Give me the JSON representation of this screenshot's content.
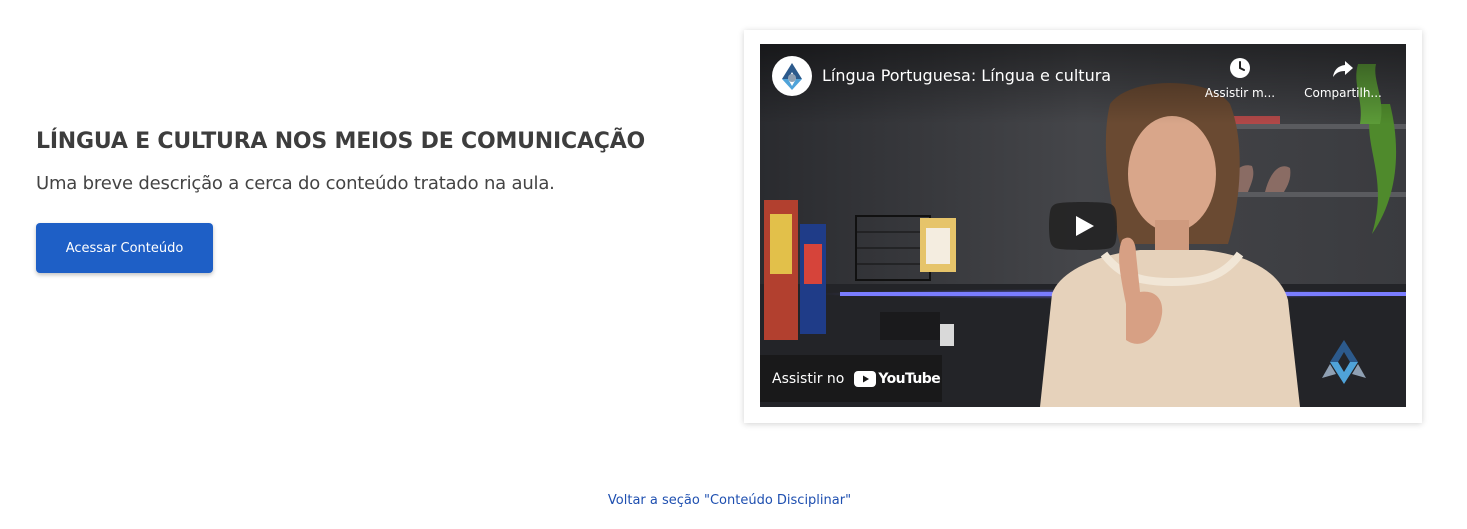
{
  "lesson": {
    "title": "LÍNGUA E CULTURA NOS MEIOS DE COMUNICAÇÃO",
    "description": "Uma breve descrição a cerca do conteúdo tratado na aula.",
    "access_button": "Acessar Conteúdo"
  },
  "video": {
    "title": "Língua Portuguesa: Língua e cultura",
    "watch_later_label": "Assistir m...",
    "share_label": "Compartilh...",
    "watch_on": "Assistir no",
    "youtube_wordmark": "YouTube",
    "icons": [
      "channel-logo-icon",
      "clock-icon",
      "share-arrow-icon",
      "play-icon",
      "youtube-logo-icon",
      "brand-logo-icon"
    ]
  },
  "footer": {
    "back_link": "Voltar a seção \"Conteúdo Disciplinar\""
  },
  "colors": {
    "button_blue": "#1e5fc6",
    "link_blue": "#1e4fb0",
    "title_text": "#3d3d3d",
    "youtube_red": "#ff0000"
  }
}
